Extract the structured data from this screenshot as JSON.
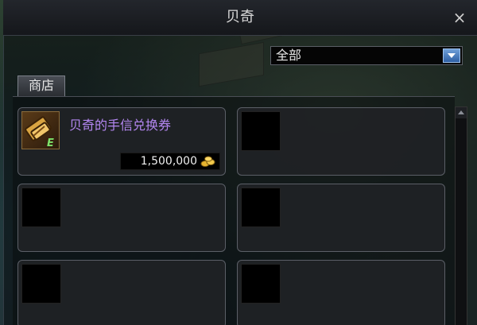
{
  "window": {
    "title": "贝奇",
    "close_label": "×"
  },
  "filter": {
    "selected": "全部"
  },
  "tabs": [
    {
      "label": "商店",
      "active": true
    }
  ],
  "items": [
    {
      "name": "贝奇的手信兑换券",
      "price": "1,500,000",
      "icon": "voucher-ticket-icon",
      "currency_icon": "gold-coins-icon",
      "name_color": "#b386f0"
    }
  ],
  "empty_slots": 5,
  "colors": {
    "accent_blue": "#2e5fa3",
    "item_purple": "#b386f0"
  }
}
